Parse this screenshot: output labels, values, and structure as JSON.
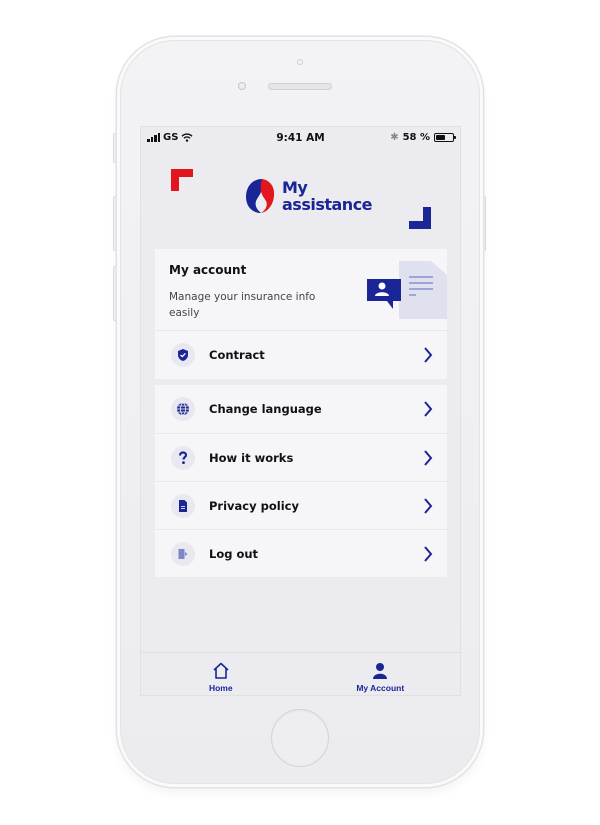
{
  "status_bar": {
    "carrier": "GS",
    "time": "9:41 AM",
    "battery_percent_label": "58 %",
    "battery_level": 0.58
  },
  "header": {
    "logo_line1": "My",
    "logo_line2": "assistance"
  },
  "account_card": {
    "title": "My account",
    "description": "Manage your insurance info easily"
  },
  "menu": {
    "contract": {
      "label": "Contract",
      "icon": "shield-check-icon"
    },
    "items": [
      {
        "label": "Change language",
        "icon": "globe-icon"
      },
      {
        "label": "How it works",
        "icon": "question-icon"
      },
      {
        "label": "Privacy policy",
        "icon": "document-icon"
      },
      {
        "label": "Log out",
        "icon": "logout-icon"
      }
    ]
  },
  "tab_bar": {
    "tabs": [
      {
        "label": "Home",
        "icon": "home-icon",
        "active": false
      },
      {
        "label": "My Account",
        "icon": "user-icon",
        "active": true
      }
    ]
  },
  "colors": {
    "brand_blue": "#1a2596",
    "brand_red": "#e3151f",
    "screen_bg": "#ececf0",
    "card_bg": "#f6f6f9"
  }
}
